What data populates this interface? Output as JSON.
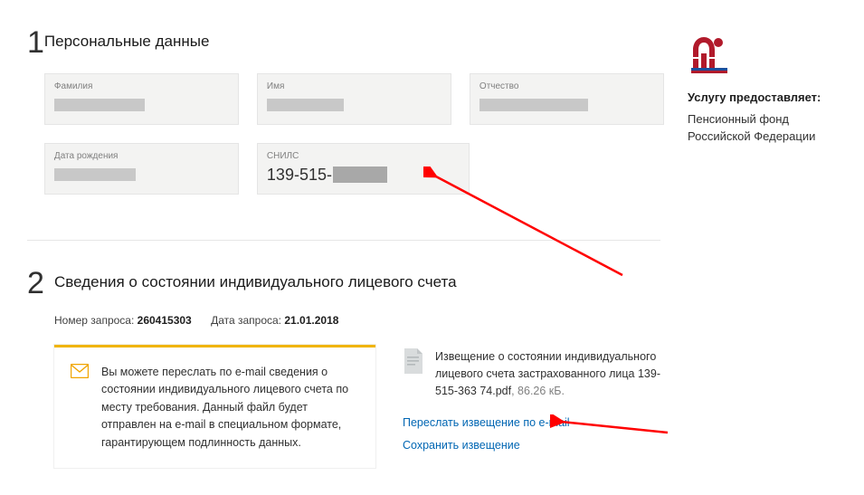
{
  "section1": {
    "num": "1",
    "title": "Персональные данные",
    "fields": {
      "surname_label": "Фамилия",
      "name_label": "Имя",
      "patronymic_label": "Отчество",
      "birth_label": "Дата рождения",
      "snils_label": "СНИЛС",
      "snils_value_visible": "139-515-"
    }
  },
  "section2": {
    "num": "2",
    "title": "Сведения о состоянии индивидуального лицевого счета",
    "request_num_label": "Номер запроса:",
    "request_num": "260415303",
    "request_date_label": "Дата запроса:",
    "request_date": "21.01.2018",
    "notice_text": "Вы можете переслать по e-mail сведения о состоянии индивидуального лицевого счета по месту требования. Данный файл будет отправлен на e-mail в специальном формате, гарантирующем подлинность данных.",
    "file_desc_prefix": "Извещение о состоянии индивидуального лицевого счета застрахованного лица ",
    "file_name": "139-515-363 74.pdf",
    "file_size": ", 86.26 кБ.",
    "link_email": "Переслать извещение по e-mail",
    "link_save": "Сохранить извещение"
  },
  "sidebar": {
    "provider_label": "Услугу предоставляет:",
    "provider_name": "Пенсионный фонд Российской Федерации"
  }
}
